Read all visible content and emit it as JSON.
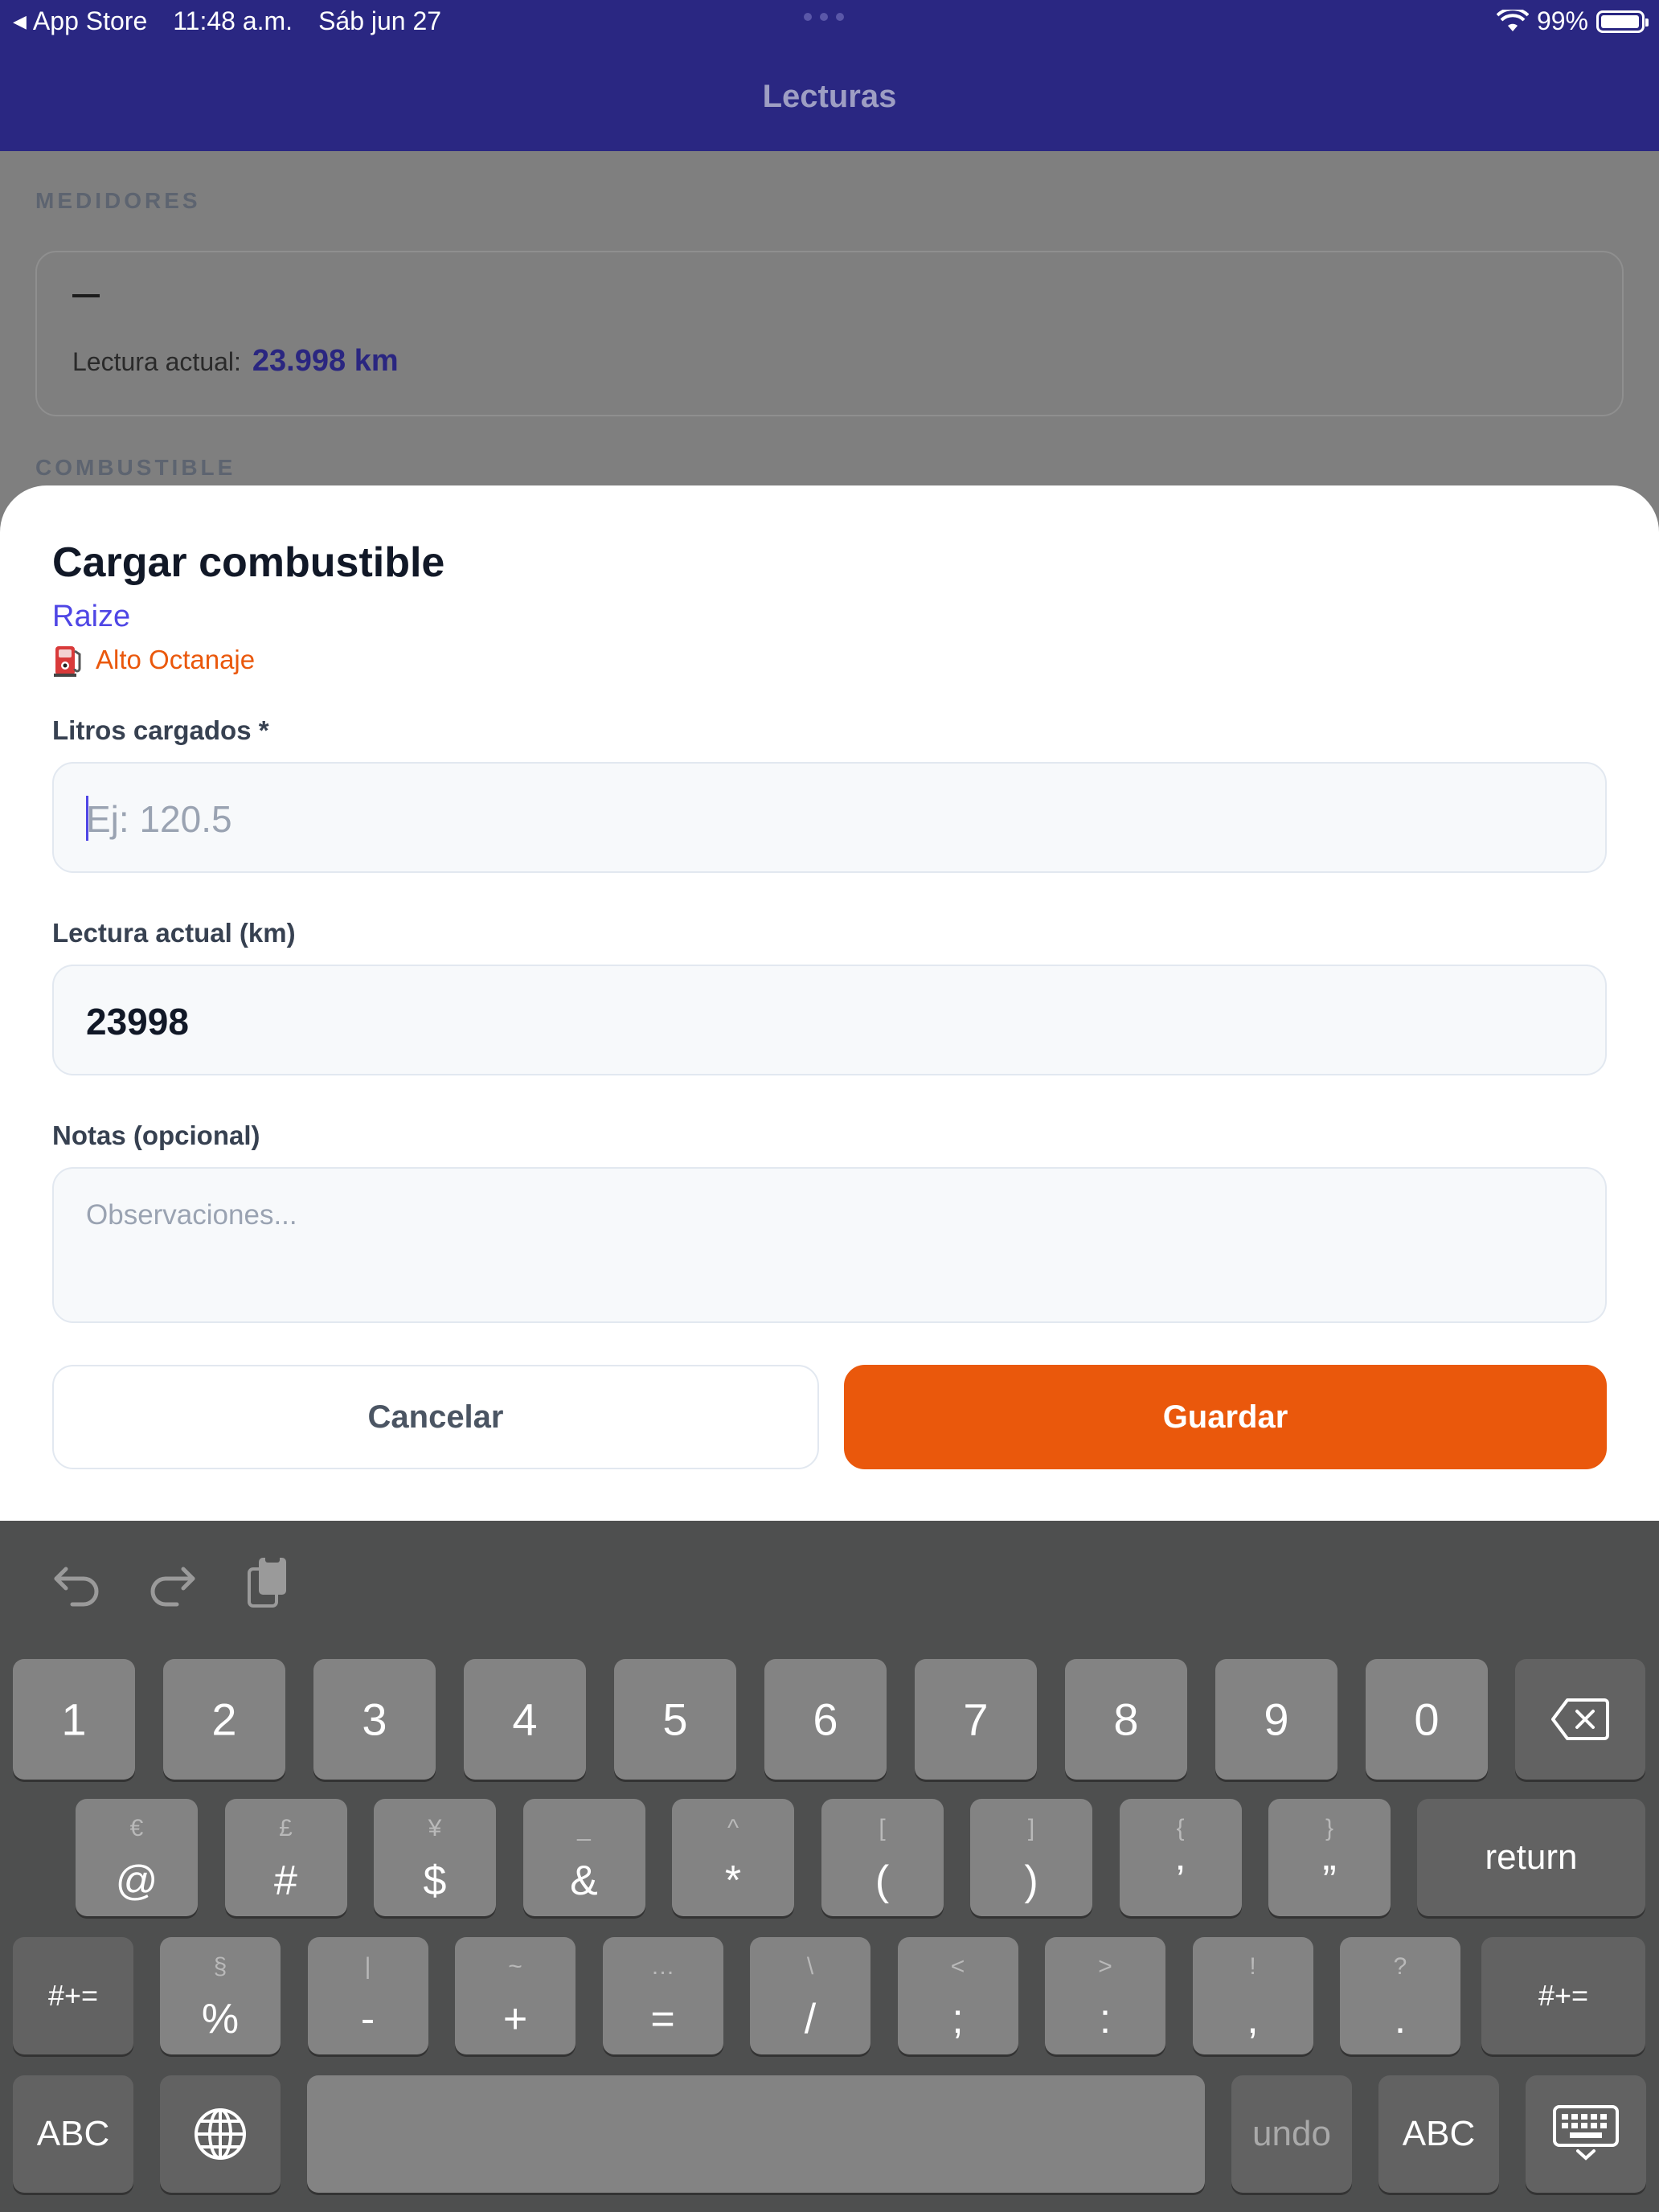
{
  "status_bar": {
    "back_app": "App Store",
    "time": "11:48 a.m.",
    "date": "Sáb jun 27",
    "battery": "99%"
  },
  "nav": {
    "title": "Lecturas"
  },
  "background": {
    "medidores_label": "MEDIDORES",
    "meter_placeholder": "—",
    "reading_label": "Lectura actual:",
    "reading_value": "23.998 km",
    "combustible_label": "COMBUSTIBLE"
  },
  "modal": {
    "title": "Cargar combustible",
    "vehicle": "Raize",
    "fuel_type": "Alto Octanaje",
    "liters_label": "Litros cargados *",
    "liters_placeholder": "Ej: 120.5",
    "reading_label": "Lectura actual (km)",
    "reading_value": "23998",
    "notes_label": "Notas (opcional)",
    "notes_placeholder": "Observaciones...",
    "cancel_label": "Cancelar",
    "save_label": "Guardar"
  },
  "keyboard": {
    "row1": [
      "1",
      "2",
      "3",
      "4",
      "5",
      "6",
      "7",
      "8",
      "9",
      "0"
    ],
    "row2": [
      {
        "alt": "€",
        "main": "@"
      },
      {
        "alt": "£",
        "main": "#"
      },
      {
        "alt": "¥",
        "main": "$"
      },
      {
        "alt": "_",
        "main": "&"
      },
      {
        "alt": "^",
        "main": "*"
      },
      {
        "alt": "[",
        "main": "("
      },
      {
        "alt": "]",
        "main": ")"
      },
      {
        "alt": "{",
        "main": "’"
      },
      {
        "alt": "}",
        "main": "”"
      }
    ],
    "return_label": "return",
    "shift_label": "#+=",
    "row3": [
      {
        "alt": "§",
        "main": "%"
      },
      {
        "alt": "|",
        "main": "-"
      },
      {
        "alt": "~",
        "main": "+"
      },
      {
        "alt": "…",
        "main": "="
      },
      {
        "alt": "\\",
        "main": "/"
      },
      {
        "alt": "<",
        "main": ";"
      },
      {
        "alt": ">",
        "main": ":"
      },
      {
        "alt": "!",
        "main": ","
      },
      {
        "alt": "?",
        "main": "."
      }
    ],
    "abc_label": "ABC",
    "undo_label": "undo",
    "icons": {
      "backspace": "backspace-icon",
      "globe": "globe-icon",
      "dismiss": "keyboard-dismiss-icon",
      "undo": "undo-arrow-icon",
      "redo": "redo-arrow-icon",
      "paste": "paste-icon"
    }
  },
  "colors": {
    "header": "#2a2782",
    "accent_indigo": "#4f46e5",
    "accent_orange": "#ea580c"
  }
}
